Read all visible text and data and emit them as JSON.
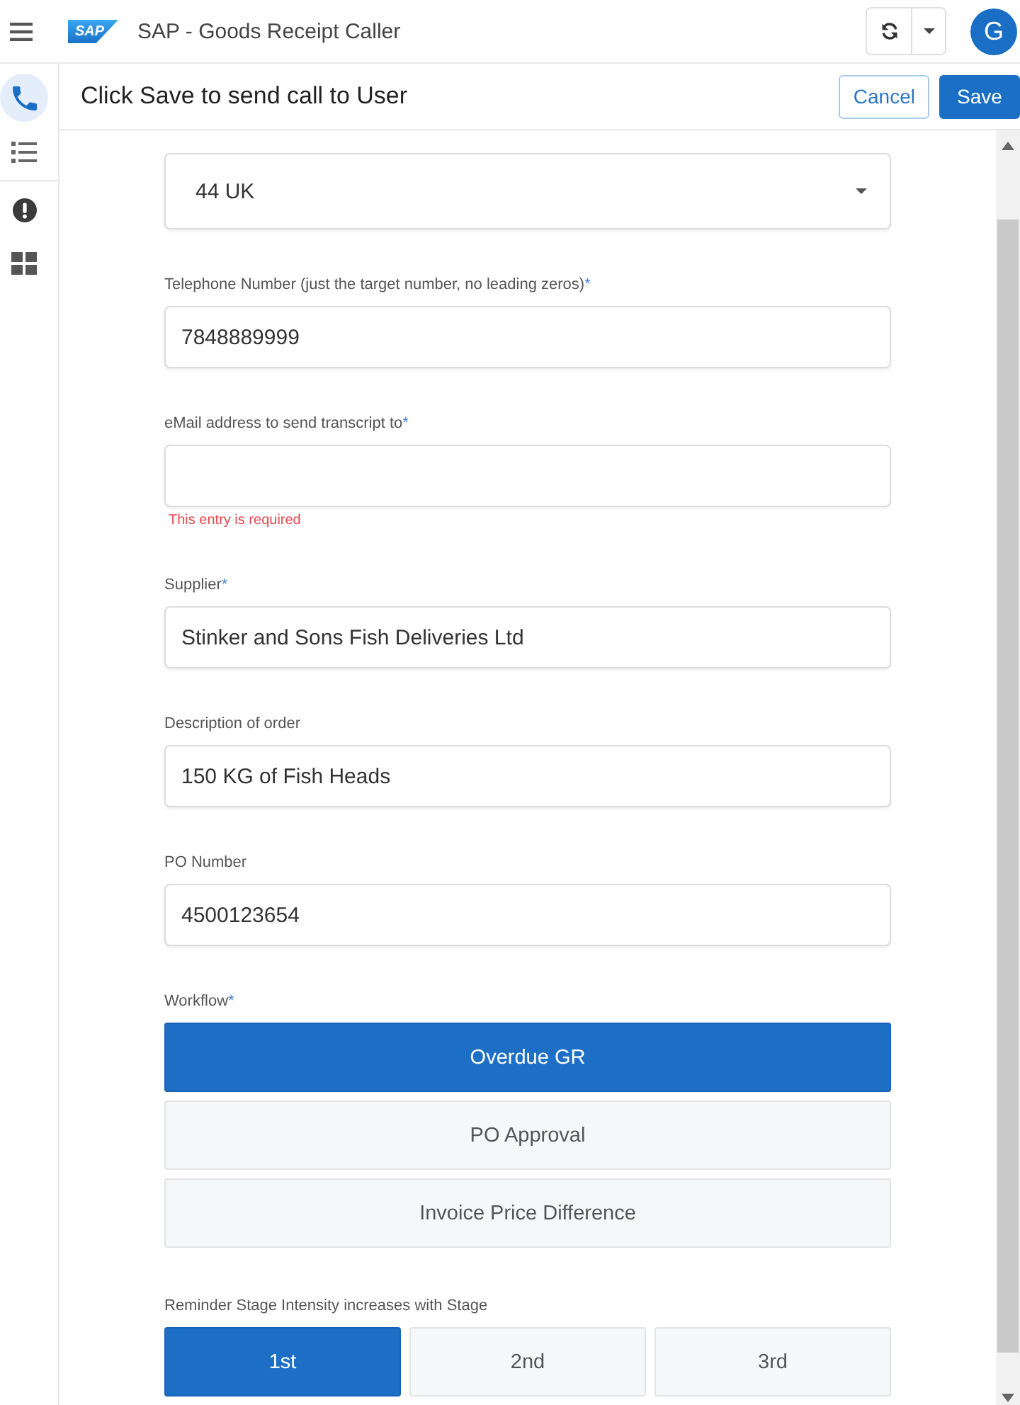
{
  "app_bar": {
    "logo_text": "SAP",
    "title": "SAP - Goods Receipt Caller",
    "avatar": "G"
  },
  "sidebar": {
    "groups": [
      {
        "items": [
          {
            "selected": true
          },
          {
            "selected": false
          }
        ]
      },
      {
        "items": [
          {
            "selected": false
          },
          {
            "selected": false
          }
        ]
      }
    ]
  },
  "toolbar": {
    "title": "Click Save to send call to User",
    "buttons": [
      {
        "label": "Cancel",
        "kind": "secondary"
      },
      {
        "label": "Save",
        "kind": "primary"
      }
    ]
  },
  "form": {
    "fields": [
      {
        "kind": "select",
        "value": "44 UK"
      },
      {
        "kind": "input",
        "label": "Telephone Number (just the target number, no leading zeros)",
        "required_mark": "*",
        "value": "7848889999"
      },
      {
        "kind": "input",
        "label": "eMail address to send transcript to",
        "required_mark": "*",
        "error": "This entry is required"
      },
      {
        "kind": "input",
        "label": "Supplier",
        "required_mark": "*",
        "value": "Stinker and Sons Fish Deliveries Ltd"
      },
      {
        "kind": "input",
        "label": "Description of order",
        "value": "150 KG of Fish Heads"
      },
      {
        "kind": "input",
        "label": "PO Number",
        "value": "4500123654"
      },
      {
        "kind": "options",
        "label": "Workflow",
        "required_mark": "*",
        "options": [
          {
            "label": "Overdue GR",
            "selected": true
          },
          {
            "label": "PO Approval",
            "selected": false
          },
          {
            "label": "Invoice Price Difference",
            "selected": false
          }
        ]
      },
      {
        "kind": "segmented",
        "label": "Reminder Stage Intensity increases with Stage",
        "options": [
          {
            "label": "1st",
            "selected": true
          },
          {
            "label": "2nd",
            "selected": false
          },
          {
            "label": "3rd",
            "selected": false
          }
        ]
      }
    ]
  }
}
